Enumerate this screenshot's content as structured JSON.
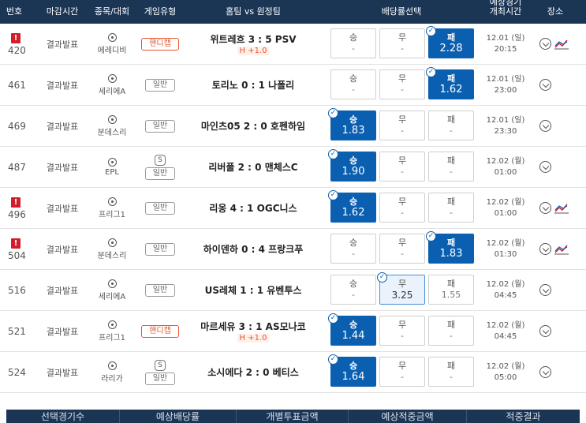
{
  "header": {
    "num": "번호",
    "deadline": "마감시간",
    "sport": "종목/대회",
    "type": "게임유형",
    "match": "홈팀 vs 원정팀",
    "odds": "배당률선택",
    "time_line1": "예상경기",
    "time_line2": "개최시간",
    "venue": "장소"
  },
  "rows": [
    {
      "num": "420",
      "alert": "!",
      "status": "결과발표",
      "league": "에레디비",
      "type": "핸디캡",
      "match": "위트레흐 3 : 5 PSV",
      "handicap": "H +1.0",
      "o1_label": "승",
      "o1_val": "-",
      "o2_label": "무",
      "o2_val": "-",
      "o3_label": "패",
      "o3_val": "2.28",
      "date": "12.01 (일)",
      "clock": "20:15"
    },
    {
      "num": "461",
      "status": "결과발표",
      "league": "세리에A",
      "type": "일반",
      "match": "토리노 0 : 1 나폴리",
      "o1_label": "승",
      "o1_val": "-",
      "o2_label": "무",
      "o2_val": "-",
      "o3_label": "패",
      "o3_val": "1.62",
      "date": "12.01 (일)",
      "clock": "23:00"
    },
    {
      "num": "469",
      "status": "결과발표",
      "league": "분데스리",
      "type": "일반",
      "match": "마인츠05 2 : 0 호펜하임",
      "o1_label": "승",
      "o1_val": "1.83",
      "o2_label": "무",
      "o2_val": "-",
      "o3_label": "패",
      "o3_val": "-",
      "date": "12.01 (일)",
      "clock": "23:30"
    },
    {
      "num": "487",
      "status": "결과발표",
      "league": "EPL",
      "type": "일반",
      "s_badge": "S",
      "match": "리버풀 2 : 0 맨체스C",
      "o1_label": "승",
      "o1_val": "1.90",
      "o2_label": "무",
      "o2_val": "-",
      "o3_label": "패",
      "o3_val": "-",
      "date": "12.02 (월)",
      "clock": "01:00"
    },
    {
      "num": "496",
      "alert": "!",
      "status": "결과발표",
      "league": "프리그1",
      "type": "일반",
      "match": "리옹 4 : 1 OGC니스",
      "o1_label": "승",
      "o1_val": "1.62",
      "o2_label": "무",
      "o2_val": "-",
      "o3_label": "패",
      "o3_val": "-",
      "date": "12.02 (월)",
      "clock": "01:00"
    },
    {
      "num": "504",
      "alert": "!",
      "status": "결과발표",
      "league": "분데스리",
      "type": "일반",
      "match": "하이덴하 0 : 4 프랑크푸",
      "o1_label": "승",
      "o1_val": "-",
      "o2_label": "무",
      "o2_val": "-",
      "o3_label": "패",
      "o3_val": "1.83",
      "date": "12.02 (월)",
      "clock": "01:30"
    },
    {
      "num": "516",
      "status": "결과발표",
      "league": "세리에A",
      "type": "일반",
      "match": "US레체 1 : 1 유벤투스",
      "o1_label": "승",
      "o1_val": "-",
      "o2_label": "무",
      "o2_val": "3.25",
      "o3_label": "패",
      "o3_val": "1.55",
      "date": "12.02 (월)",
      "clock": "04:45"
    },
    {
      "num": "521",
      "status": "결과발표",
      "league": "프리그1",
      "type": "핸디캡",
      "match": "마르세유 3 : 1 AS모나코",
      "handicap": "H +1.0",
      "o1_label": "승",
      "o1_val": "1.44",
      "o2_label": "무",
      "o2_val": "-",
      "o3_label": "패",
      "o3_val": "-",
      "date": "12.02 (월)",
      "clock": "04:45"
    },
    {
      "num": "524",
      "status": "결과발표",
      "league": "라리가",
      "type": "일반",
      "s_badge": "S",
      "match": "소시에다 2 : 0 베티스",
      "o1_label": "승",
      "o1_val": "1.64",
      "o2_label": "무",
      "o2_val": "-",
      "o3_label": "패",
      "o3_val": "-",
      "date": "12.02 (월)",
      "clock": "05:00"
    }
  ],
  "footer": {
    "count": "선택경기수",
    "exp_odds": "예상배당률",
    "stake": "개별투표금액",
    "exp_win": "예상적중금액",
    "result": "적중결과"
  },
  "colors": {
    "header_bg": "#1b3555",
    "selected": "#0b5fb0",
    "handicap": "#e4572e",
    "alert": "#d11e2a"
  },
  "icons": {
    "venue": "map-pin-icon",
    "stats": "trend-chart-icon",
    "sport": "soccer-ball-icon",
    "check": "check-circle-icon"
  }
}
